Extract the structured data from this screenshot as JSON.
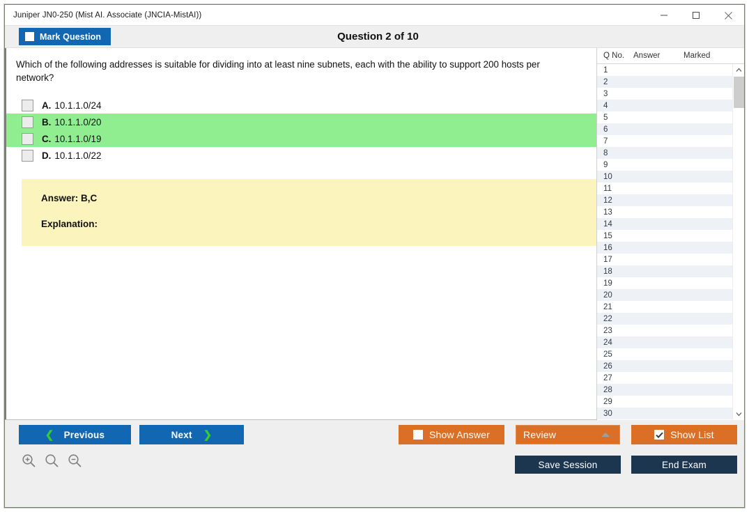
{
  "window": {
    "title": "Juniper JN0-250 (Mist AI. Associate (JNCIA-MistAI))",
    "minimize_label": "minimize-icon",
    "maximize_label": "maximize-icon",
    "close_label": "close-icon"
  },
  "header": {
    "mark_question_label": "Mark Question",
    "question_counter": "Question 2 of 10"
  },
  "question": {
    "text": "Which of the following addresses is suitable for dividing into at least nine subnets, each with the ability to support 200 hosts per network?",
    "options": [
      {
        "letter": "A.",
        "text": "10.1.1.0/24",
        "highlight": false,
        "checked": false
      },
      {
        "letter": "B.",
        "text": "10.1.1.0/20",
        "highlight": true,
        "checked": false
      },
      {
        "letter": "C.",
        "text": "10.1.1.0/19",
        "highlight": true,
        "checked": false
      },
      {
        "letter": "D.",
        "text": "10.1.1.0/22",
        "highlight": false,
        "checked": false
      }
    ],
    "answer_label": "Answer: B,C",
    "explanation_label": "Explanation:"
  },
  "list_panel": {
    "columns": [
      "Q No.",
      "Answer",
      "Marked"
    ],
    "rows": [
      {
        "no": "1",
        "answer": "",
        "marked": ""
      },
      {
        "no": "2",
        "answer": "",
        "marked": ""
      },
      {
        "no": "3",
        "answer": "",
        "marked": ""
      },
      {
        "no": "4",
        "answer": "",
        "marked": ""
      },
      {
        "no": "5",
        "answer": "",
        "marked": ""
      },
      {
        "no": "6",
        "answer": "",
        "marked": ""
      },
      {
        "no": "7",
        "answer": "",
        "marked": ""
      },
      {
        "no": "8",
        "answer": "",
        "marked": ""
      },
      {
        "no": "9",
        "answer": "",
        "marked": ""
      },
      {
        "no": "10",
        "answer": "",
        "marked": ""
      },
      {
        "no": "11",
        "answer": "",
        "marked": ""
      },
      {
        "no": "12",
        "answer": "",
        "marked": ""
      },
      {
        "no": "13",
        "answer": "",
        "marked": ""
      },
      {
        "no": "14",
        "answer": "",
        "marked": ""
      },
      {
        "no": "15",
        "answer": "",
        "marked": ""
      },
      {
        "no": "16",
        "answer": "",
        "marked": ""
      },
      {
        "no": "17",
        "answer": "",
        "marked": ""
      },
      {
        "no": "18",
        "answer": "",
        "marked": ""
      },
      {
        "no": "19",
        "answer": "",
        "marked": ""
      },
      {
        "no": "20",
        "answer": "",
        "marked": ""
      },
      {
        "no": "21",
        "answer": "",
        "marked": ""
      },
      {
        "no": "22",
        "answer": "",
        "marked": ""
      },
      {
        "no": "23",
        "answer": "",
        "marked": ""
      },
      {
        "no": "24",
        "answer": "",
        "marked": ""
      },
      {
        "no": "25",
        "answer": "",
        "marked": ""
      },
      {
        "no": "26",
        "answer": "",
        "marked": ""
      },
      {
        "no": "27",
        "answer": "",
        "marked": ""
      },
      {
        "no": "28",
        "answer": "",
        "marked": ""
      },
      {
        "no": "29",
        "answer": "",
        "marked": ""
      },
      {
        "no": "30",
        "answer": "",
        "marked": ""
      }
    ],
    "scroll_up_icon": "chevron-up-icon",
    "scroll_down_icon": "chevron-down-icon"
  },
  "footer": {
    "previous_label": "Previous",
    "next_label": "Next",
    "show_answer_label": "Show Answer",
    "review_label": "Review",
    "show_list_label": "Show List",
    "save_session_label": "Save Session",
    "end_exam_label": "End Exam",
    "show_answer_checked": false,
    "show_list_checked": true,
    "zoom_in_icon": "zoom-in-icon",
    "zoom_reset_icon": "zoom-icon",
    "zoom_out_icon": "zoom-out-icon"
  },
  "colors": {
    "primary_blue": "#1267b2",
    "accent_orange": "#da6f25",
    "navy": "#1d3650",
    "highlight_green": "#90ee90",
    "answer_yellow": "#fbf4bc",
    "chevron_green": "#33cc33"
  }
}
